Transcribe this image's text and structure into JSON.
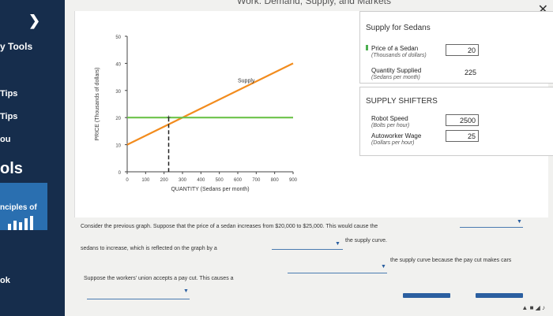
{
  "sidebar": {
    "items": [
      {
        "label": "y Tools"
      },
      {
        "label": "Tips"
      },
      {
        "label": "Tips"
      },
      {
        "label": "ou"
      },
      {
        "label": "ols"
      },
      {
        "label": "nciples of"
      },
      {
        "label": "ok"
      }
    ],
    "colors": {
      "bg": "#162d4c",
      "banner": "#2a6fb0"
    }
  },
  "header": {
    "title": "Demand, Supply, and Markets",
    "title_visible": "Work: Demand, Supply, and Markets"
  },
  "chart_data": {
    "type": "line",
    "ylabel": "PRICE (Thousands of dollars)",
    "xlabel": "QUANTITY (Sedans per month)",
    "xlim": [
      0,
      900
    ],
    "ylim": [
      0,
      50
    ],
    "x_ticks": [
      0,
      100,
      200,
      300,
      400,
      500,
      600,
      700,
      800,
      900
    ],
    "y_ticks": [
      0,
      10,
      20,
      30,
      40,
      50
    ],
    "series": [
      {
        "name": "Supply",
        "color": "#f28c1e",
        "points": [
          [
            0,
            10
          ],
          [
            900,
            40
          ]
        ]
      },
      {
        "name": "",
        "color": "#6cc24a",
        "points": [
          [
            0,
            20
          ],
          [
            900,
            20
          ]
        ]
      }
    ],
    "marker": {
      "x": 225,
      "y": 20
    },
    "grid": false
  },
  "supply_panel": {
    "title": "Supply for Sedans",
    "price_label": "Price of a Sedan",
    "price_unit": "(Thousands of dollars)",
    "price_value": "20",
    "qty_label": "Quantity Supplied",
    "qty_unit": "(Sedans per month)",
    "qty_value": "225"
  },
  "shifters_panel": {
    "title": "SUPPLY SHIFTERS",
    "robot_label": "Robot Speed",
    "robot_unit": "(Bolts per hour)",
    "robot_value": "2500",
    "wage_label": "Autoworker Wage",
    "wage_unit": "(Dollars per hour)",
    "wage_value": "25"
  },
  "questions": {
    "q1_part1": "Consider the previous graph. Suppose that the price of a sedan increases from $20,000 to $25,000. This would cause the",
    "q1_part2": "sedans to increase, which is reflected on the graph by a",
    "q1_part3": "the supply curve.",
    "q2_part1": "Suppose the workers' union accepts a pay cut. This causes a",
    "q2_part2": "the supply curve because the pay cut makes cars"
  }
}
